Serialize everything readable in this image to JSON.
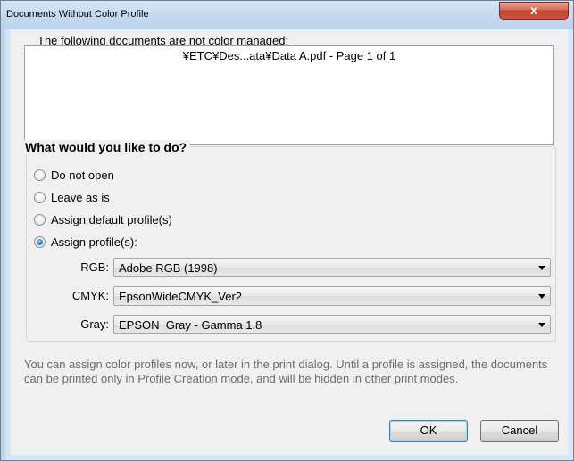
{
  "window": {
    "title": "Documents Without Color Profile",
    "close_glyph": "x"
  },
  "documents": {
    "label": "The following documents are not color managed:",
    "items": [
      "¥ETC¥Des...ata¥Data A.pdf - Page 1 of 1"
    ]
  },
  "options": {
    "title": "What would you like to do?",
    "radios": [
      {
        "label": "Do not open",
        "checked": false
      },
      {
        "label": "Leave as is",
        "checked": false
      },
      {
        "label": "Assign default profile(s)",
        "checked": false
      },
      {
        "label": "Assign profile(s):",
        "checked": true
      }
    ],
    "profiles": [
      {
        "label": "RGB:",
        "value": "Adobe RGB (1998)"
      },
      {
        "label": "CMYK:",
        "value": "EpsonWideCMYK_Ver2"
      },
      {
        "label": "Gray:",
        "value": "EPSON  Gray - Gamma 1.8"
      }
    ]
  },
  "info": "You can assign color profiles now, or later in the print dialog. Until a profile is assigned, the documents can be printed only in Profile Creation mode, and will be hidden in other print modes.",
  "buttons": {
    "ok": "OK",
    "cancel": "Cancel"
  }
}
